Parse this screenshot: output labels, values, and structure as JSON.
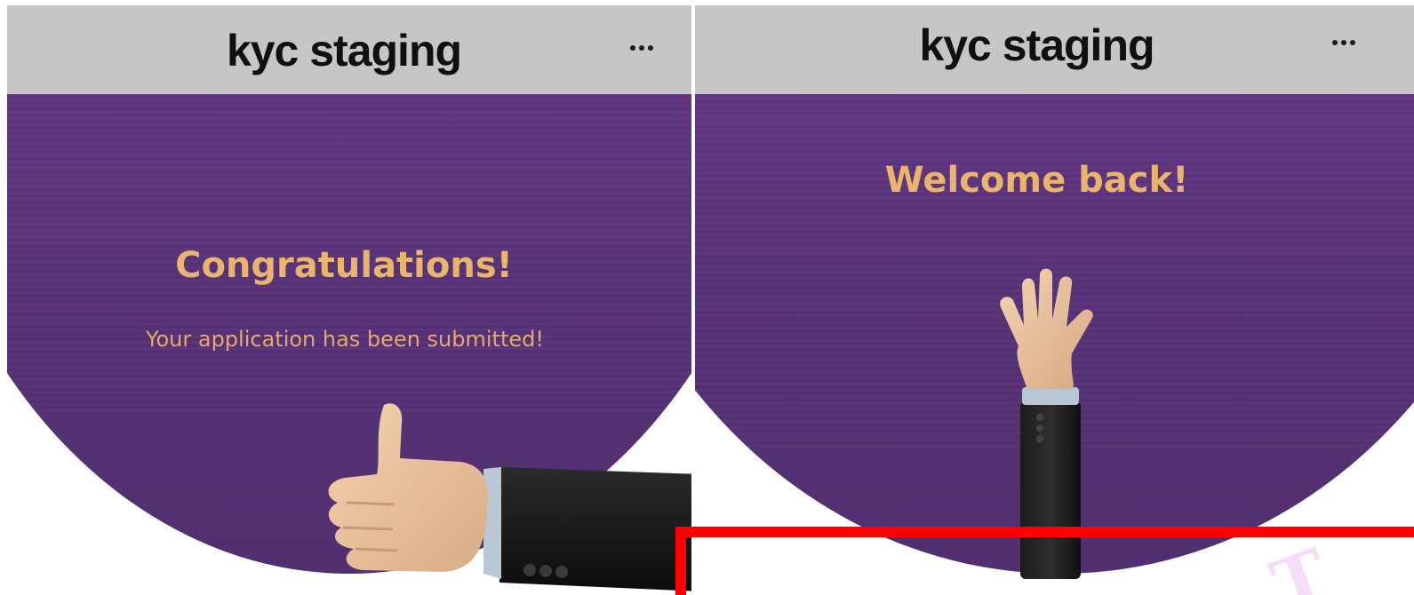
{
  "screens": [
    {
      "app_title": "kyc staging",
      "more_label": "...",
      "heading": "Congratulations!",
      "subtitle": "Your application has been submitted!",
      "illustration": "thumbs-up-hand"
    },
    {
      "app_title": "kyc staging",
      "more_label": "...",
      "heading": "Welcome back!",
      "illustration": "waving-hand"
    }
  ],
  "colors": {
    "topbar": "#c6c6c6",
    "hero_purple": "#643784",
    "heading_gold": "#e9b46c",
    "highlight_red": "#ff0000"
  },
  "watermark_text": "T"
}
